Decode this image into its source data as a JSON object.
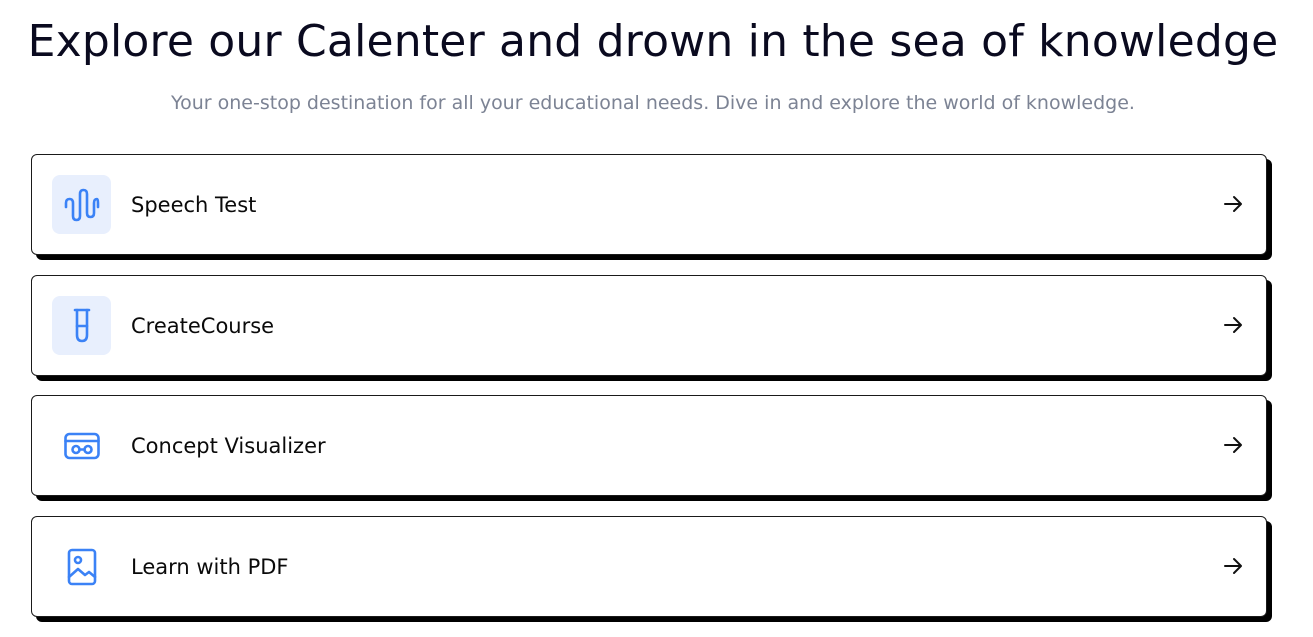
{
  "header": {
    "title": "Explore our Calenter and drown in the sea of knowledge",
    "subtitle": "Your one-stop destination for all your educational needs. Dive in and explore the world of knowledge."
  },
  "colors": {
    "accent": "#3b82f6",
    "icon_bg": "#e8effd",
    "subtitle": "#7c8394",
    "border": "#1a1a1a"
  },
  "features": [
    {
      "label": "Speech Test",
      "icon": "sound-wave-icon"
    },
    {
      "label": "CreateCourse",
      "icon": "test-tube-icon"
    },
    {
      "label": "Concept Visualizer",
      "icon": "vr-headset-icon"
    },
    {
      "label": "Learn with PDF",
      "icon": "image-file-icon"
    }
  ]
}
